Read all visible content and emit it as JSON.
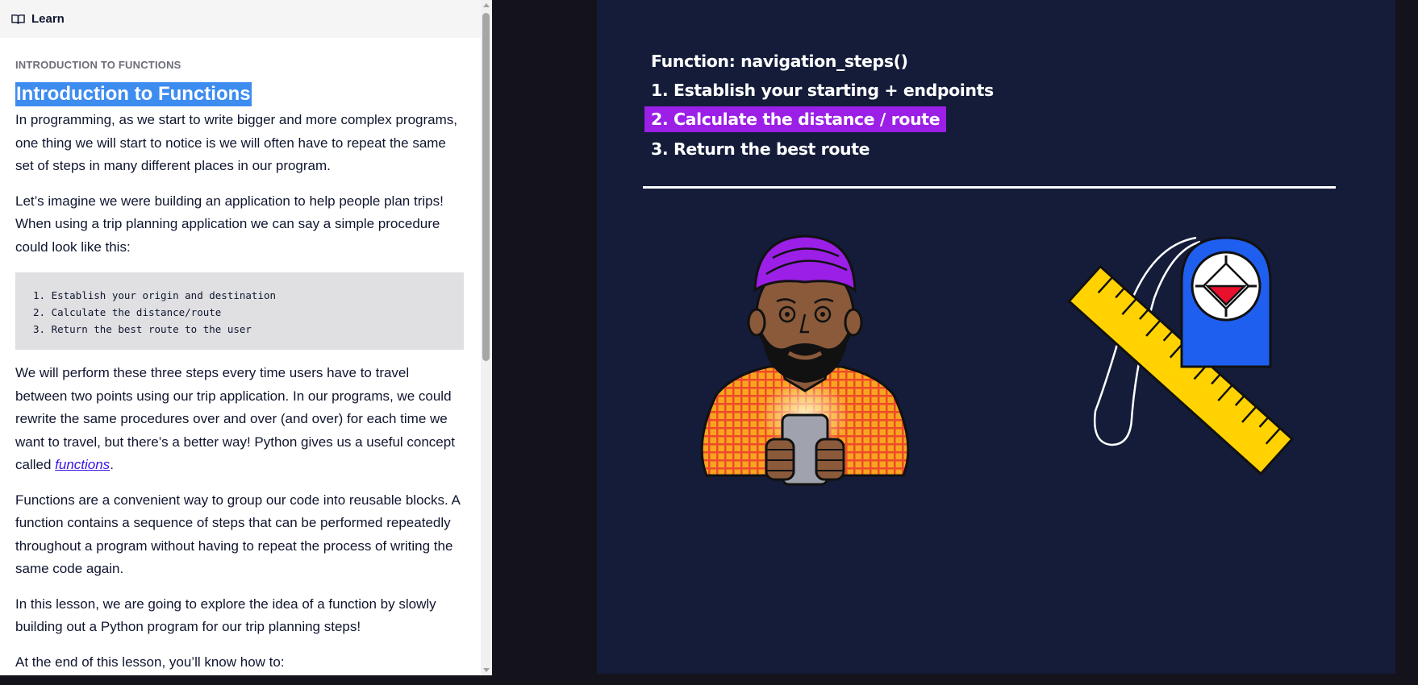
{
  "header": {
    "label": "Learn",
    "icon": "book-icon"
  },
  "lesson": {
    "kicker": "INTRODUCTION TO FUNCTIONS",
    "title": "Introduction to Functions",
    "p1": "In programming, as we start to write bigger and more complex programs, one thing we will start to notice is we will often have to repeat the same set of steps in many different places in our program.",
    "p2": "Let’s imagine we were building an application to help people plan trips! When using a trip planning application we can say a simple procedure could look like this:",
    "code_lines": [
      "1. Establish your origin and destination",
      "2. Calculate the distance/route",
      "3. Return the best route to the user"
    ],
    "p3_before": "We will perform these three steps every time users have to travel between two points using our trip application. In our programs, we could rewrite the same procedures over and over (and over) for each time we want to travel, but there’s a better way! Python gives us a useful concept called ",
    "p3_link": "functions",
    "p3_after": ".",
    "p4": "Functions are a convenient way to group our code into reusable blocks. A function contains a sequence of steps that can be performed repeatedly throughout a program without having to repeat the process of writing the same code again.",
    "p5": "In this lesson, we are going to explore the idea of a function by slowly building out a Python program for our trip planning steps!",
    "p6": "At the end of this lesson, you’ll know how to:"
  },
  "slide": {
    "title": "Function: navigation_steps()",
    "step1": "1. Establish your starting + endpoints",
    "step2": "2. Calculate the distance / route",
    "step3": "3. Return the best route",
    "highlight_color": "#9b1fe6",
    "background_color": "#141c3a"
  },
  "colors": {
    "selection": "#3d8cf0",
    "link": "#3a10e5",
    "code_bg": "#e0e0e3"
  }
}
